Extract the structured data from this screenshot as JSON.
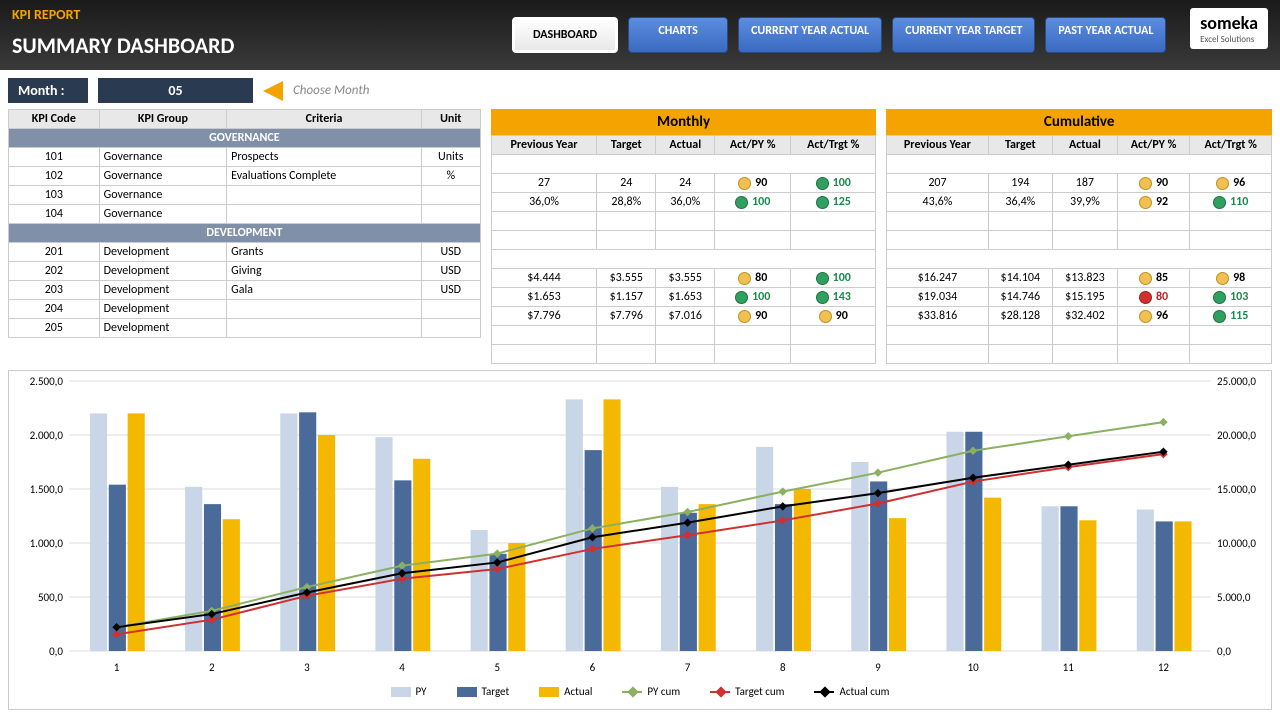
{
  "header": {
    "title": "KPI REPORT",
    "subtitle": "SUMMARY DASHBOARD"
  },
  "tabs": [
    "DASHBOARD",
    "CHARTS",
    "CURRENT YEAR ACTUAL",
    "CURRENT YEAR TARGET",
    "PAST YEAR ACTUAL"
  ],
  "logo": {
    "name": "someka",
    "sub": "Excel Solutions"
  },
  "month": {
    "label": "Month :",
    "value": "05",
    "hint": "Choose Month"
  },
  "cols_left": [
    "KPI Code",
    "KPI Group",
    "Criteria",
    "Unit"
  ],
  "band_monthly": "Monthly",
  "band_cum": "Cumulative",
  "cols_m": [
    "Previous Year",
    "Target",
    "Actual",
    "Act/PY %",
    "Act/Trgt %"
  ],
  "groups": [
    {
      "name": "GOVERNANCE",
      "rows": [
        {
          "code": "101",
          "grp": "Governance",
          "crit": "Prospects",
          "unit": "Units",
          "m": {
            "py": "27",
            "t": "24",
            "a": "24",
            "p1": "90",
            "c1": "y",
            "p2": "100",
            "c2": "g"
          },
          "c": {
            "py": "207",
            "t": "194",
            "a": "187",
            "p1": "90",
            "c1": "y",
            "p2": "96",
            "c2": "y"
          }
        },
        {
          "code": "102",
          "grp": "Governance",
          "crit": "Evaluations Complete",
          "unit": "%",
          "m": {
            "py": "36,0%",
            "t": "28,8%",
            "a": "36,0%",
            "p1": "100",
            "c1": "g",
            "p2": "125",
            "c2": "g"
          },
          "c": {
            "py": "43,6%",
            "t": "36,4%",
            "a": "39,9%",
            "p1": "92",
            "c1": "y",
            "p2": "110",
            "c2": "g"
          }
        },
        {
          "code": "103",
          "grp": "Governance"
        },
        {
          "code": "104",
          "grp": "Governance"
        }
      ]
    },
    {
      "name": "DEVELOPMENT",
      "rows": [
        {
          "code": "201",
          "grp": "Development",
          "crit": "Grants",
          "unit": "USD",
          "m": {
            "py": "$4.444",
            "t": "$3.555",
            "a": "$3.555",
            "p1": "80",
            "c1": "y",
            "p2": "100",
            "c2": "g"
          },
          "c": {
            "py": "$16.247",
            "t": "$14.104",
            "a": "$13.823",
            "p1": "85",
            "c1": "y",
            "p2": "98",
            "c2": "y"
          }
        },
        {
          "code": "202",
          "grp": "Development",
          "crit": "Giving",
          "unit": "USD",
          "m": {
            "py": "$1.653",
            "t": "$1.157",
            "a": "$1.653",
            "p1": "100",
            "c1": "g",
            "p2": "143",
            "c2": "g"
          },
          "c": {
            "py": "$19.034",
            "t": "$14.746",
            "a": "$15.195",
            "p1": "80",
            "c1": "r",
            "p2": "103",
            "c2": "g"
          }
        },
        {
          "code": "203",
          "grp": "Development",
          "crit": "Gala",
          "unit": "USD",
          "m": {
            "py": "$7.796",
            "t": "$7.796",
            "a": "$7.016",
            "p1": "90",
            "c1": "y",
            "p2": "90",
            "c2": "y"
          },
          "c": {
            "py": "$33.816",
            "t": "$28.128",
            "a": "$32.402",
            "p1": "96",
            "c1": "y",
            "p2": "115",
            "c2": "g"
          }
        },
        {
          "code": "204",
          "grp": "Development"
        },
        {
          "code": "205",
          "grp": "Development"
        }
      ]
    }
  ],
  "chart_data": {
    "type": "bar+line",
    "categories": [
      1,
      2,
      3,
      4,
      5,
      6,
      7,
      8,
      9,
      10,
      11,
      12
    ],
    "ylim_left": [
      0,
      2500
    ],
    "ylim_right": [
      0,
      25000
    ],
    "y_ticks_left": [
      "0,0",
      "500,0",
      "1.000,0",
      "1.500,0",
      "2.000,0",
      "2.500,0"
    ],
    "y_ticks_right": [
      "0,0",
      "5.000,0",
      "10.000,0",
      "15.000,0",
      "20.000,0",
      "25.000,0"
    ],
    "series": [
      {
        "name": "PY",
        "type": "bar",
        "color": "#c8d6e8",
        "values": [
          2200,
          1520,
          2200,
          1980,
          1120,
          2330,
          1520,
          1890,
          1750,
          2030,
          1340,
          1310
        ]
      },
      {
        "name": "Target",
        "type": "bar",
        "color": "#4a6a9a",
        "values": [
          1540,
          1360,
          2210,
          1580,
          900,
          1860,
          1280,
          1360,
          1570,
          2030,
          1340,
          1200
        ]
      },
      {
        "name": "Actual",
        "type": "bar",
        "color": "#f5b800",
        "values": [
          2200,
          1220,
          2000,
          1780,
          1000,
          2330,
          1360,
          1500,
          1230,
          1420,
          1210,
          1200
        ]
      },
      {
        "name": "PY cum",
        "type": "line",
        "color": "#8ab060",
        "values": [
          2200,
          3720,
          5920,
          7900,
          9020,
          11350,
          12870,
          14760,
          16510,
          18540,
          19880,
          21190
        ]
      },
      {
        "name": "Target cum",
        "type": "line",
        "color": "#d03030",
        "values": [
          1540,
          2900,
          5110,
          6690,
          7590,
          9450,
          10730,
          12090,
          13660,
          15690,
          17030,
          18230
        ]
      },
      {
        "name": "Actual cum",
        "type": "line",
        "color": "#000",
        "values": [
          2200,
          3420,
          5420,
          7200,
          8200,
          10530,
          11890,
          13390,
          14620,
          16040,
          17250,
          18450
        ]
      }
    ],
    "legend": [
      "PY",
      "Target",
      "Actual",
      "PY cum",
      "Target cum",
      "Actual cum"
    ]
  }
}
